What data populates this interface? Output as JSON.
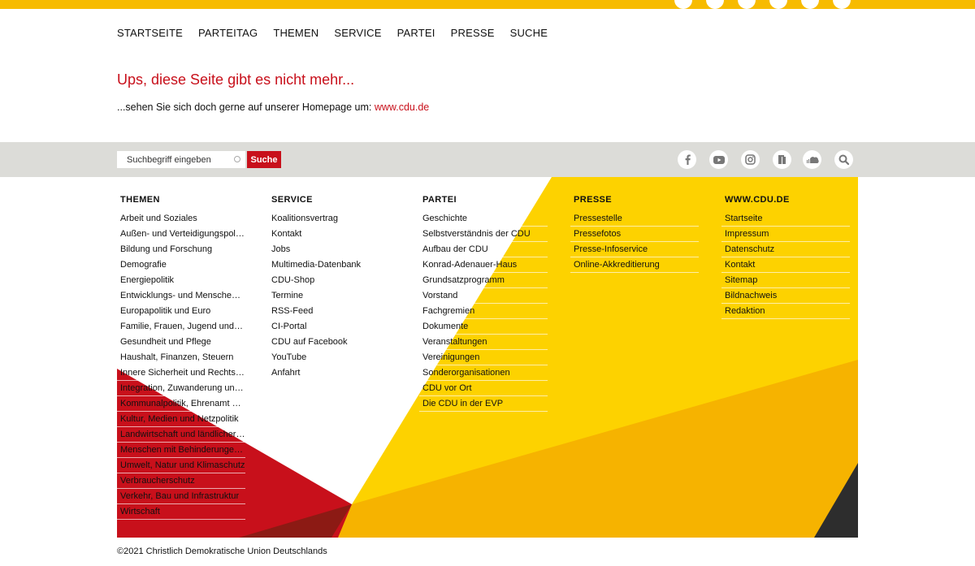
{
  "nav": [
    "STARTSEITE",
    "PARTEITAG",
    "THEMEN",
    "SERVICE",
    "PARTEI",
    "PRESSE",
    "SUCHE"
  ],
  "error": {
    "title": "Ups, diese Seite gibt es nicht mehr...",
    "text": "...sehen Sie sich doch gerne auf unserer Homepage um: ",
    "link": "www.cdu.de"
  },
  "search": {
    "placeholder": "Suchbegriff eingeben",
    "button": "Suche"
  },
  "social_icons": [
    "facebook-icon",
    "youtube-icon",
    "instagram-icon",
    "newsletter-icon",
    "soundcloud-icon",
    "search-icon"
  ],
  "footer": {
    "columns": [
      {
        "title": "THEMEN",
        "items": [
          "Arbeit und Soziales",
          "Außen- und Verteidigungspolitik",
          "Bildung und Forschung",
          "Demografie",
          "Energiepolitik",
          "Entwicklungs- und Menschenre...",
          "Europapolitik und Euro",
          "Familie, Frauen, Jugend und Sen...",
          "Gesundheit und Pflege",
          "Haushalt, Finanzen, Steuern",
          "Innere Sicherheit und Rechtspol...",
          "Integration, Zuwanderung und ...",
          "Kommunalpolitik, Ehrenamt un...",
          "Kultur, Medien und Netzpolitik",
          "Landwirtschaft und ländlicher R...",
          "Menschen mit Behinderungen/I...",
          "Umwelt, Natur und Klimaschutz",
          "Verbraucherschutz",
          "Verkehr, Bau und Infrastruktur",
          "Wirtschaft"
        ]
      },
      {
        "title": "SERVICE",
        "items": [
          "Koalitionsvertrag",
          "Kontakt",
          "Jobs",
          "Multimedia-Datenbank",
          "CDU-Shop",
          "Termine",
          "RSS-Feed",
          "CI-Portal",
          "CDU auf Facebook",
          "YouTube",
          "Anfahrt"
        ]
      },
      {
        "title": "PARTEI",
        "items": [
          "Geschichte",
          "Selbstverständnis der CDU",
          "Aufbau der CDU",
          "Konrad-Adenauer-Haus",
          "Grundsatzprogramm",
          "Vorstand",
          "Fachgremien",
          "Dokumente",
          "Veranstaltungen",
          "Vereinigungen",
          "Sonderorganisationen",
          "CDU vor Ort",
          "Die CDU in der EVP"
        ]
      },
      {
        "title": "PRESSE",
        "items": [
          "Pressestelle",
          "Pressefotos",
          "Presse-Infoservice",
          "Online-Akkreditierung"
        ]
      },
      {
        "title": "WWW.CDU.DE",
        "items": [
          "Startseite",
          "Impressum",
          "Datenschutz",
          "Kontakt",
          "Sitemap",
          "Bildnachweis",
          "Redaktion"
        ]
      }
    ],
    "colors": {
      "red": "#c8101b",
      "yellow": "#fdd200",
      "orange": "#f6b300",
      "darkred": "#8c1a14",
      "black": "#2d2d2d"
    }
  },
  "copyright": "©2021 Christlich Demokratische Union Deutschlands"
}
